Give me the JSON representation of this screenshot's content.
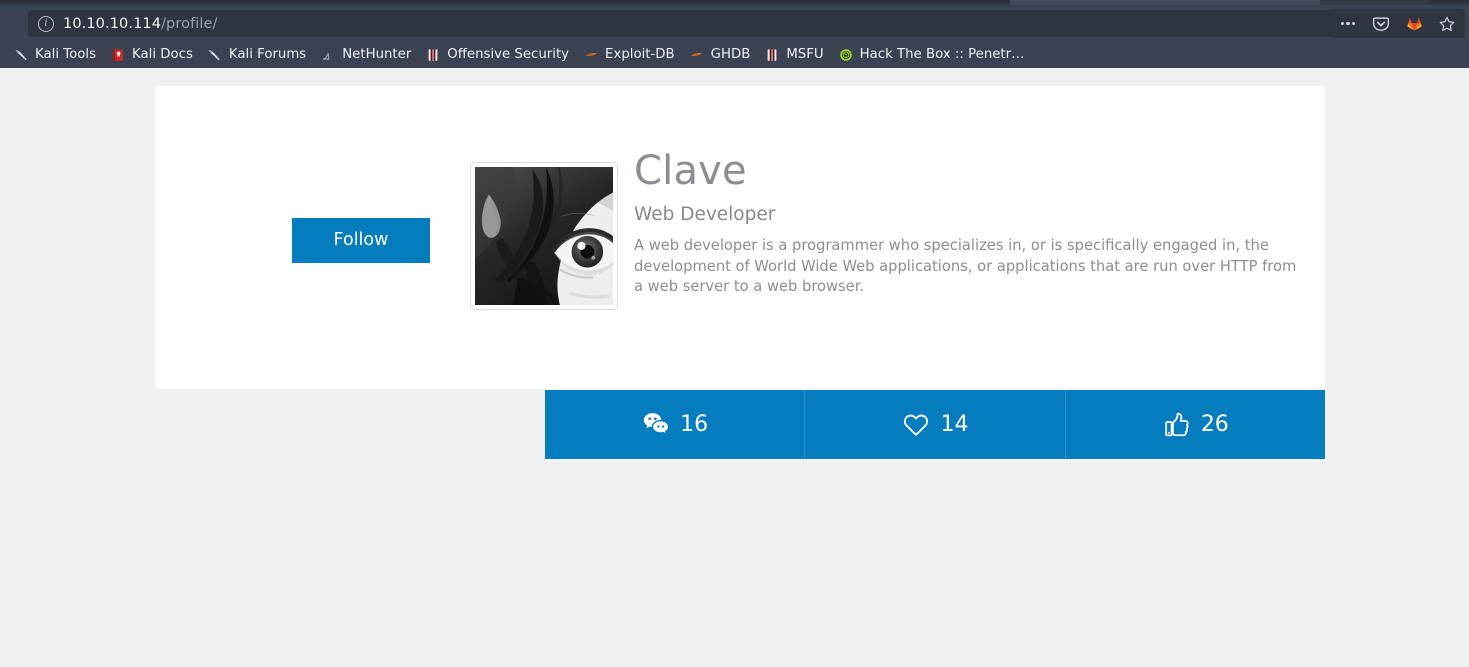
{
  "browser": {
    "url": {
      "host": "10.10.10.114",
      "path": "/profile/",
      "security_icon": "info-circle-icon"
    },
    "actions": [
      {
        "name": "page-actions-menu",
        "icon": "ellipsis-icon"
      },
      {
        "name": "pocket-save",
        "icon": "pocket-shield-icon"
      },
      {
        "name": "gitlab-extension",
        "icon": "gitlab-fox-icon"
      },
      {
        "name": "bookmark-star",
        "icon": "star-outline-icon"
      }
    ],
    "bookmarks": [
      {
        "label": "Kali Tools",
        "icon": "kali-dragon-icon"
      },
      {
        "label": "Kali Docs",
        "icon": "red-book-icon"
      },
      {
        "label": "Kali Forums",
        "icon": "kali-dragon-icon"
      },
      {
        "label": "NetHunter",
        "icon": "nethunter-icon"
      },
      {
        "label": "Offensive Security",
        "icon": "offsec-pillar-icon"
      },
      {
        "label": "Exploit-DB",
        "icon": "exploitdb-flame-icon"
      },
      {
        "label": "GHDB",
        "icon": "exploitdb-flame-icon"
      },
      {
        "label": "MSFU",
        "icon": "offsec-pillar-icon"
      },
      {
        "label": "Hack The Box :: Penetr…",
        "icon": "htb-green-icon"
      }
    ]
  },
  "profile": {
    "follow_button": "Follow",
    "avatar_alt": "grayscale close-up portrait photo",
    "name": "Clave",
    "role": "Web Developer",
    "bio": "A web developer is a programmer who specializes in, or is specifically engaged in, the development of World Wide Web applications, or applications that are run over HTTP from a web server to a web browser."
  },
  "stats": [
    {
      "name": "comments",
      "icon": "chat-bubbles-icon",
      "value": "16"
    },
    {
      "name": "likes",
      "icon": "heart-outline-icon",
      "value": "14"
    },
    {
      "name": "thumbs-up",
      "icon": "thumbs-up-icon",
      "value": "26"
    }
  ],
  "colors": {
    "accent": "#057cbd",
    "page_background": "#f0f0f0",
    "card_background": "#ffffff",
    "chrome_background": "#3b4252",
    "text_muted": "#8b8e92"
  }
}
